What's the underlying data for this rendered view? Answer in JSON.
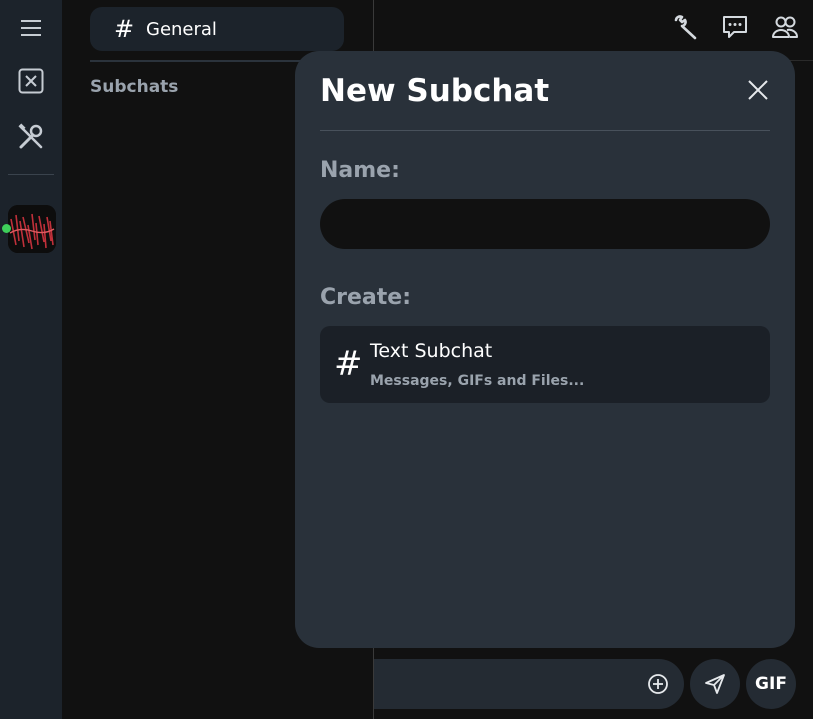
{
  "channels": {
    "active_channel": {
      "hash": "#",
      "name": "General"
    },
    "section_label": "Subchats"
  },
  "composer": {
    "gif_label": "GIF"
  },
  "modal": {
    "title": "New Subchat",
    "name_label": "Name:",
    "name_value": "",
    "create_label": "Create:",
    "options": [
      {
        "hash": "#",
        "title": "Text Subchat",
        "description": "Messages, GIFs and Files..."
      }
    ]
  },
  "icons": {
    "rail": [
      "menu-icon",
      "close-box-icon",
      "tools-icon"
    ],
    "header": [
      "wrench-icon",
      "chat-bubble-icon",
      "members-icon"
    ],
    "composer": [
      "plus-circle-icon",
      "send-icon"
    ],
    "modal": [
      "close-icon"
    ]
  },
  "colors": {
    "rail_bg": "#1c232b",
    "main_bg": "#111111",
    "modal_bg": "#29313a",
    "option_bg": "#1b2027",
    "muted_text": "#9aa3ad",
    "online": "#3ecf5a",
    "server_accent": "#c0303a"
  }
}
